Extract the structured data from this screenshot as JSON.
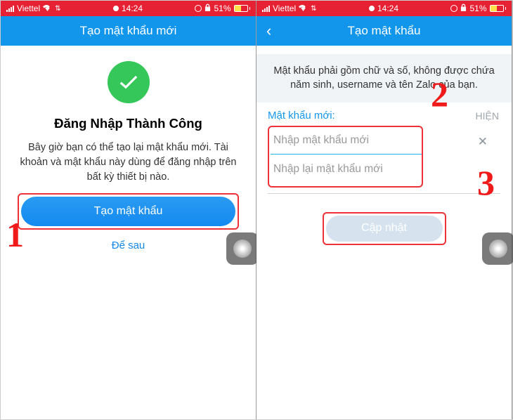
{
  "status": {
    "carrier": "Viettel",
    "time": "14:24",
    "battery_pct": "51%"
  },
  "left": {
    "header": "Tạo mật khẩu mới",
    "success_title": "Đăng Nhập Thành Công",
    "success_text": "Bây giờ bạn có thể tạo lại mật khẩu mới. Tài khoản và mật khẩu này dùng để đăng nhập trên bất kỳ thiết bị nào.",
    "create_btn": "Tạo mật khẩu",
    "later": "Để sau"
  },
  "right": {
    "header": "Tạo mật khẩu",
    "instruction": "Mật khẩu phải gồm chữ và số, không được chứa năm sinh, username và tên Zalo của bạn.",
    "field_label": "Mật khẩu mới:",
    "show": "HIỆN",
    "ph_new": "Nhập mật khẩu mới",
    "ph_confirm": "Nhập lại mật khẩu mới",
    "update_btn": "Cập nhật"
  },
  "callouts": {
    "one": "1",
    "two": "2",
    "three": "3"
  }
}
